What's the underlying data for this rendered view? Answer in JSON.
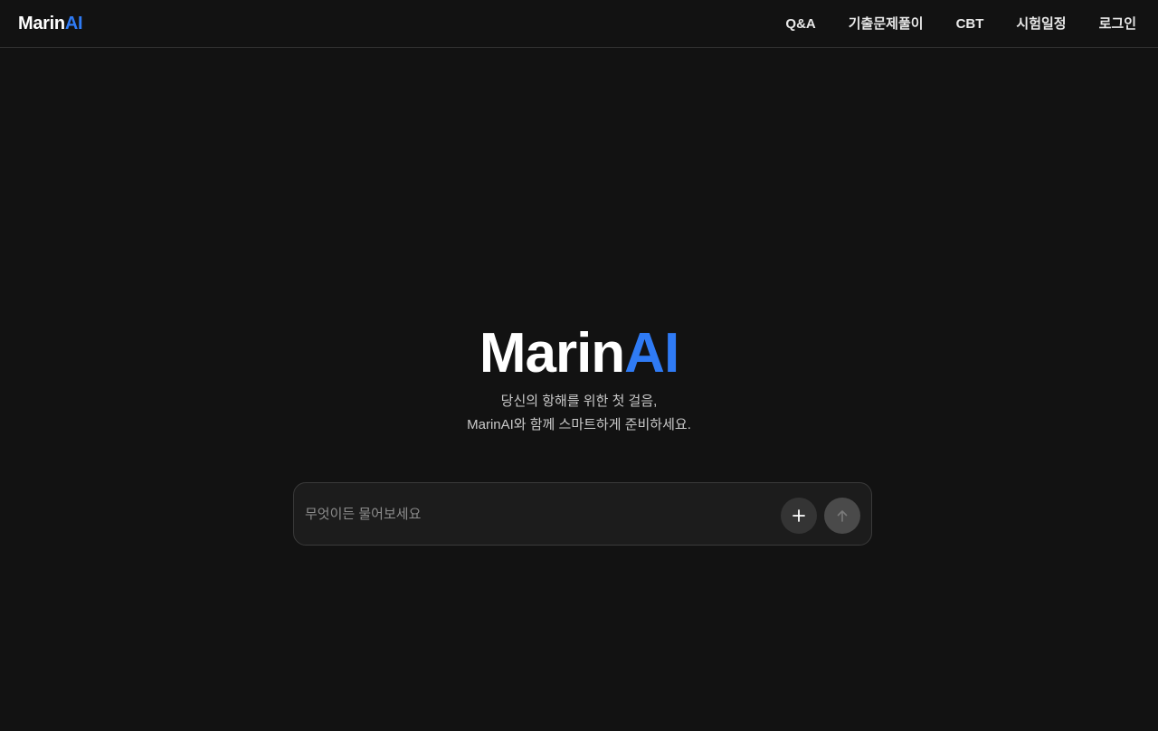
{
  "header": {
    "logo": {
      "part1": "Marin",
      "part2": "AI"
    },
    "nav": [
      {
        "label": "Q&A"
      },
      {
        "label": "기출문제풀이"
      },
      {
        "label": "CBT"
      },
      {
        "label": "시험일정"
      },
      {
        "label": "로그인"
      }
    ]
  },
  "hero": {
    "title": {
      "part1": "Marin",
      "part2": "AI"
    },
    "subtitle_line1": "당신의 항해를 위한 첫 걸음,",
    "subtitle_line2": "MarinAI와 함께 스마트하게 준비하세요."
  },
  "ask": {
    "placeholder": "무엇이든 물어보세요",
    "value": "",
    "add_icon": "plus-icon",
    "send_icon": "arrow-up-icon"
  },
  "colors": {
    "background": "#121212",
    "accent": "#2f7bf5",
    "input_bg": "#1c1c1c",
    "input_border": "#3a3a3a"
  }
}
